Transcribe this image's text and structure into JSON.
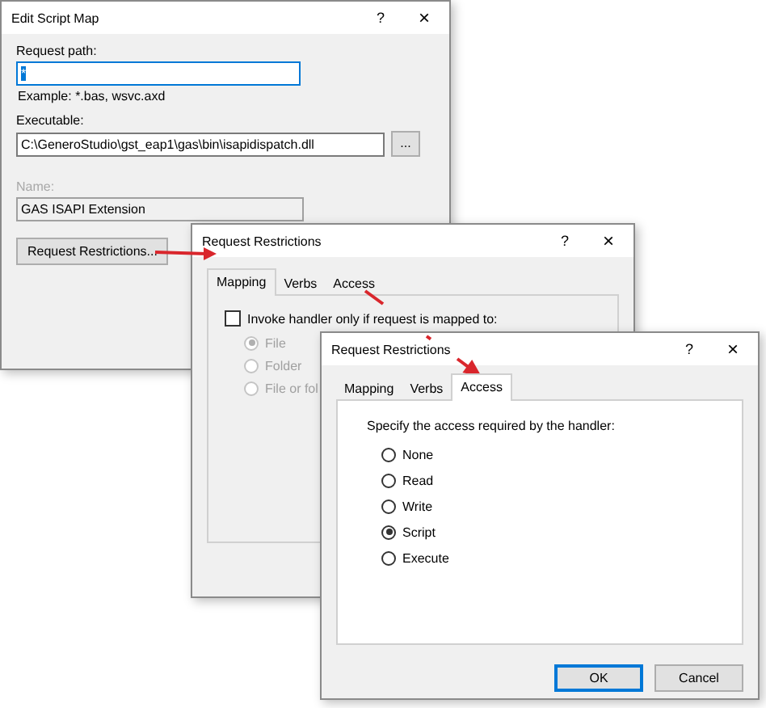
{
  "edit_script_map": {
    "title": "Edit Script Map",
    "help": "?",
    "close": "×",
    "request_path": {
      "label": "Request path:",
      "value": "*",
      "focused": true
    },
    "example": "Example: *.bas, wsvc.axd",
    "executable": {
      "label": "Executable:",
      "value": "C:\\GeneroStudio\\gst_eap1\\gas\\bin\\isapidispatch.dll",
      "browse": "..."
    },
    "name": {
      "label": "Name:",
      "value": "GAS ISAPI Extension",
      "disabled": true
    },
    "restrictions_button": "Request Restrictions..."
  },
  "mapping_dialog": {
    "title": "Request Restrictions",
    "help": "?",
    "close": "×",
    "tabs": [
      {
        "label": "Mapping",
        "selected": true
      },
      {
        "label": "Verbs",
        "selected": false
      },
      {
        "label": "Access",
        "selected": false
      }
    ],
    "invoke_checkbox": {
      "label": "Invoke handler only if request is mapped to:",
      "checked": false
    },
    "options": [
      {
        "label": "File",
        "selected": true,
        "disabled": true
      },
      {
        "label": "Folder",
        "selected": false,
        "disabled": true
      },
      {
        "label": "File or fol",
        "selected": false,
        "disabled": true
      }
    ]
  },
  "access_dialog": {
    "title": "Request Restrictions",
    "help": "?",
    "close": "×",
    "tabs": [
      {
        "label": "Mapping",
        "selected": false
      },
      {
        "label": "Verbs",
        "selected": false
      },
      {
        "label": "Access",
        "selected": true
      }
    ],
    "prompt": "Specify the access required by the handler:",
    "options": [
      {
        "label": "None",
        "selected": false
      },
      {
        "label": "Read",
        "selected": false
      },
      {
        "label": "Write",
        "selected": false
      },
      {
        "label": "Script",
        "selected": true
      },
      {
        "label": "Execute",
        "selected": false
      }
    ],
    "buttons": [
      {
        "label": "OK",
        "default": true
      },
      {
        "label": "Cancel",
        "default": false
      }
    ]
  }
}
